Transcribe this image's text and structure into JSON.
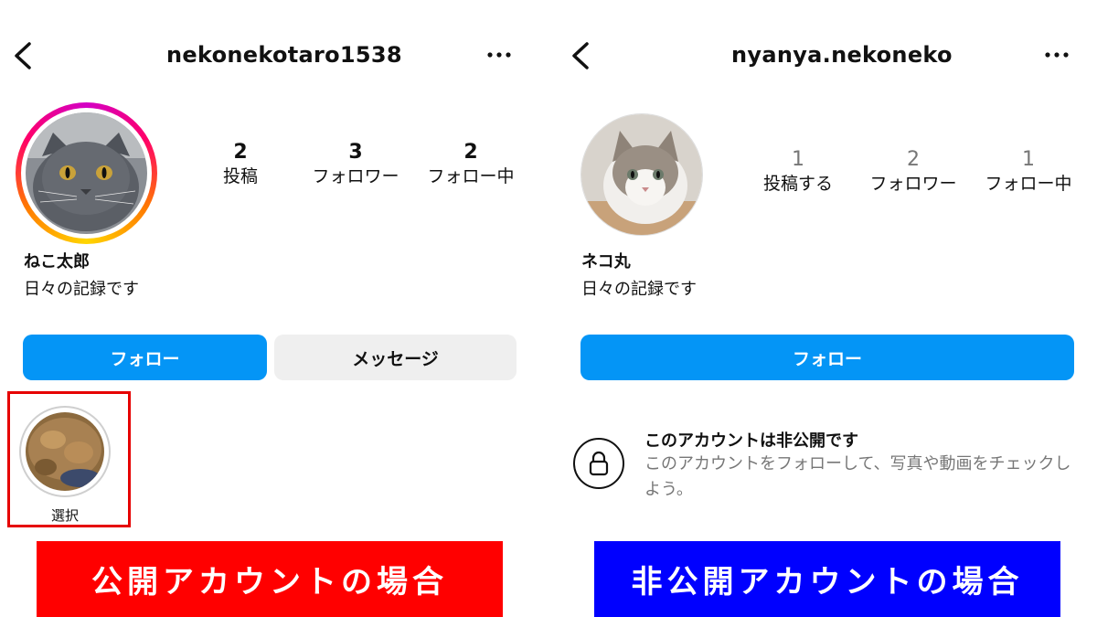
{
  "colors": {
    "follow_blue": "#0495f6",
    "highlight_red": "#e60000",
    "banner_red": "#ff0000",
    "banner_blue": "#0000ff"
  },
  "public_profile": {
    "username": "nekonekotaro1538",
    "stats": [
      {
        "value": "2",
        "label": "投稿"
      },
      {
        "value": "3",
        "label": "フォロワー"
      },
      {
        "value": "2",
        "label": "フォロー中"
      }
    ],
    "display_name": "ねこ太郎",
    "bio": "日々の記録です",
    "follow_label": "フォロー",
    "message_label": "メッセージ",
    "highlight_label": "選択",
    "banner": "公開アカウントの場合"
  },
  "private_profile": {
    "username": "nyanya.nekoneko",
    "stats": [
      {
        "value": "1",
        "label": "投稿する"
      },
      {
        "value": "2",
        "label": "フォロワー"
      },
      {
        "value": "1",
        "label": "フォロー中"
      }
    ],
    "display_name": "ネコ丸",
    "bio": "日々の記録です",
    "follow_label": "フォロー",
    "private_title": "このアカウントは非公開です",
    "private_desc": "このアカウントをフォローして、写真や動画をチェックしよう。",
    "banner": "非公開アカウントの場合"
  }
}
